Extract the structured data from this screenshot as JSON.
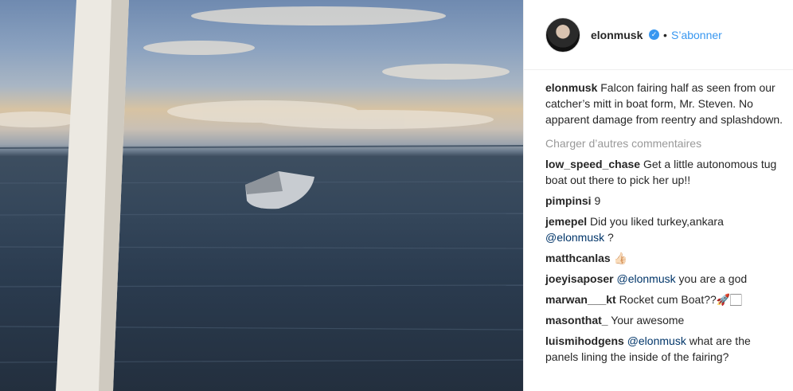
{
  "post": {
    "photo_description_icon": "photo",
    "author": "elonmusk",
    "verified_icon": "verified-badge-icon",
    "separator": "•",
    "follow_label": "S’abonner"
  },
  "caption": {
    "user": "elonmusk",
    "text": "Falcon fairing half as seen from our catcher’s mitt in boat form, Mr. Steven. No apparent damage from reentry and splashdown."
  },
  "load_more_label": "Charger d’autres commentaires",
  "comments": [
    {
      "user": "low_speed_chase",
      "text": "Get a little autonomous tug boat out there to pick her up!!"
    },
    {
      "user": "pimpinsi",
      "text": "9"
    },
    {
      "user": "jemepel",
      "text": "Did you liked turkey,ankara",
      "mention": "@elonmusk",
      "after": " ?"
    },
    {
      "user": "matthcanlas",
      "text": "👍🏻"
    },
    {
      "user": "joeyisaposer",
      "mention": "@elonmusk",
      "after": " you are a god"
    },
    {
      "user": "marwan___kt",
      "text": "Rocket cum Boat??🚀🏻"
    },
    {
      "user": "masonthat_",
      "text": "Your awesome"
    },
    {
      "user": "luismihodgens",
      "mention": "@elonmusk",
      "after": " what are the panels lining the inside of the fairing?"
    }
  ]
}
